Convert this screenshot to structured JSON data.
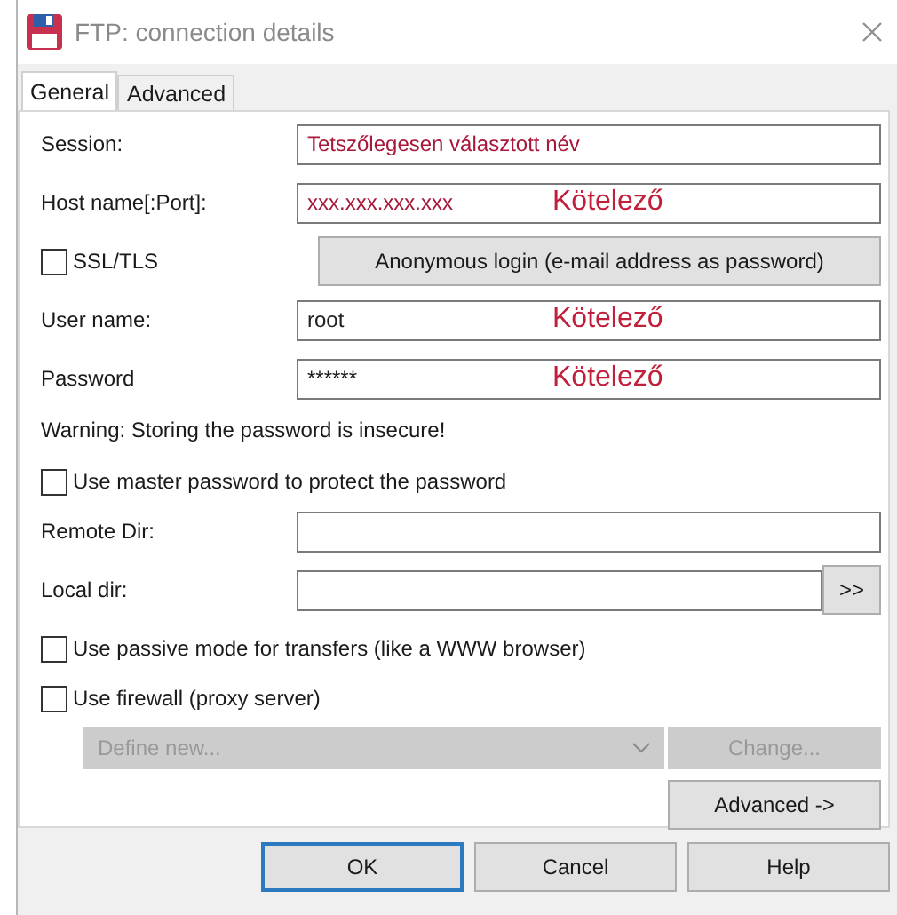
{
  "window": {
    "title": "FTP: connection details"
  },
  "tabs": [
    {
      "label": "General",
      "selected": true
    },
    {
      "label": "Advanced",
      "selected": false
    }
  ],
  "rows": [
    {
      "kind": "field",
      "label": "Session:",
      "value": "Tetszőlegesen választott név",
      "color": "#a8183a"
    },
    {
      "kind": "field",
      "label": "Host name[:Port]:",
      "value": "xxx.xxx.xxx.xxx",
      "note": "Kötelező",
      "color": "#a8183a"
    },
    {
      "kind": "check_button",
      "label": "SSL/TLS",
      "checked": false,
      "button": "Anonymous login (e-mail address as password)"
    },
    {
      "kind": "field",
      "label": "User name:",
      "value": "root",
      "note": "Kötelező",
      "color": "#202020"
    },
    {
      "kind": "field",
      "label": "Password",
      "value": "******",
      "note": "Kötelező",
      "color": "#202020"
    },
    {
      "kind": "text",
      "label": "Warning: Storing the password is insecure!"
    },
    {
      "kind": "check",
      "label": "Use master password to protect the password",
      "checked": false
    },
    {
      "kind": "field",
      "label": "Remote Dir:"
    },
    {
      "kind": "browse",
      "label": "Local dir:",
      "button": ">>"
    },
    {
      "kind": "check",
      "label": "Use passive mode for transfers (like a WWW browser)",
      "checked": false
    },
    {
      "kind": "check",
      "label": "Use firewall (proxy server)",
      "checked": false
    },
    {
      "kind": "combo",
      "value": "Define new...",
      "button": "Change...",
      "disabled": true
    },
    {
      "kind": "right_button",
      "button": "Advanced ->"
    }
  ],
  "buttons": [
    {
      "label": "OK",
      "default": true
    },
    {
      "label": "Cancel",
      "default": false
    },
    {
      "label": "Help",
      "default": false
    }
  ]
}
